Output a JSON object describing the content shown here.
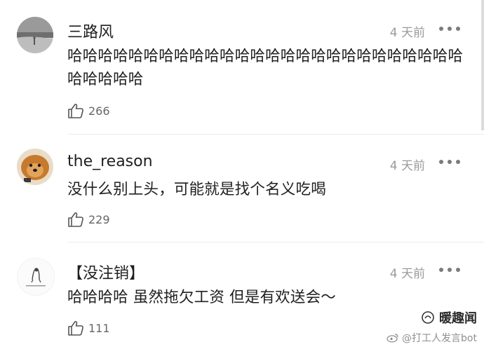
{
  "comments": [
    {
      "username": "三路风",
      "time": "4 天前",
      "text": "哈哈哈哈哈哈哈哈哈哈哈哈哈哈哈哈哈哈哈哈哈哈哈哈哈哈哈哈哈哈哈",
      "likes": "266",
      "avatar_icon": "avatar-grey-landscape"
    },
    {
      "username": "the_reason",
      "time": "4 天前",
      "text": "没什么别上头，可能就是找个名义吃喝",
      "likes": "229",
      "avatar_icon": "avatar-pomeranian-dog"
    },
    {
      "username": "【没注销】",
      "time": "4 天前",
      "text": "哈哈哈哈 虽然拖欠工资 但是有欢送会～",
      "likes": "111",
      "avatar_icon": "avatar-sketch-figure"
    }
  ],
  "watermark": {
    "brand": "暖趣闻",
    "handle": "@打工人发言bot"
  },
  "colors": {
    "text": "#202020",
    "meta": "#9a9a9a",
    "divider": "#ececec"
  }
}
